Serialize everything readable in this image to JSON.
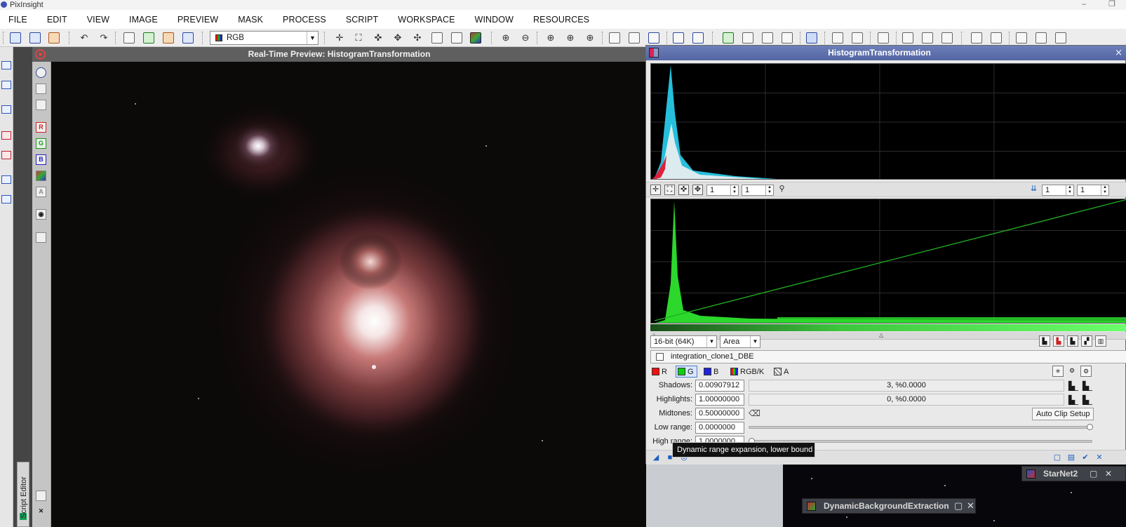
{
  "app": {
    "title": "PixInsight"
  },
  "menu": [
    "FILE",
    "EDIT",
    "VIEW",
    "IMAGE",
    "PREVIEW",
    "MASK",
    "PROCESS",
    "SCRIPT",
    "WORKSPACE",
    "WINDOW",
    "RESOURCES"
  ],
  "toolbar": {
    "channel_select": "RGB"
  },
  "preview": {
    "title": "Real-Time Preview: HistogramTransformation",
    "tool_buttons": [
      "R",
      "G",
      "B",
      "A"
    ]
  },
  "side_panel": {
    "script_editor_label": "Script Editor"
  },
  "histogram_transformation": {
    "title": "HistogramTransformation",
    "zoom": {
      "upper_h": "1",
      "upper_v": "1",
      "lower_h": "1",
      "lower_v": "1"
    },
    "resolution": "16-bit (64K)",
    "graph_style": "Area",
    "target_view": "integration_clone1_DBE",
    "channels": [
      "R",
      "G",
      "B",
      "RGB/K",
      "A"
    ],
    "selected_channel": "G",
    "shadows_label": "Shadows:",
    "shadows": "0.00907912",
    "shadows_clip": "3, %0.0000",
    "highlights_label": "Highlights:",
    "highlights": "1.00000000",
    "highlights_clip": "0, %0.0000",
    "midtones_label": "Midtones:",
    "midtones": "0.50000000",
    "auto_clip_setup": "Auto Clip Setup",
    "low_range_label": "Low range:",
    "low_range": "0.0000000",
    "high_range_label": "High range:",
    "high_range": "1.0000000"
  },
  "tooltip": "Dynamic range expansion, lower bound",
  "background_windows": {
    "starnet": "StarNet2",
    "dbe": "DynamicBackgroundExtraction"
  },
  "colors": {
    "preview_title_bg": "#5f5f5f",
    "ht_title_bg": "#5366a4",
    "histogram_green": "#2bd82b",
    "histogram_cyan": "#27c9e8",
    "histogram_red": "#e0203a",
    "transfer_curve": "#22b022"
  }
}
